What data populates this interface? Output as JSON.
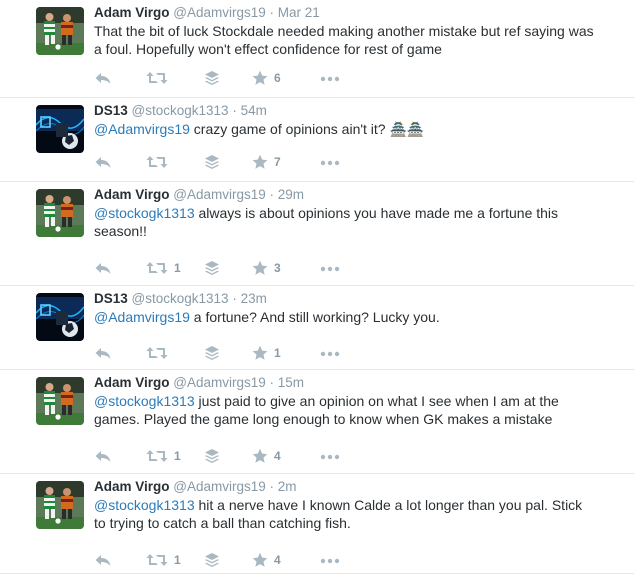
{
  "tweets": [
    {
      "name": "Adam Virgo",
      "handle": "@Adamvirgs19",
      "time": "· Mar 21",
      "mention": "",
      "text": "That the bit of luck Stockdale needed making another mistake but ref saying was a foul. Hopefully won't effect confidence for rest of game",
      "retweets": "",
      "likes": "6",
      "avatar": "football"
    },
    {
      "name": "DS13",
      "handle": "@stockogk1313",
      "time": "· 54m",
      "mention": "@Adamvirgs19",
      "text": " crazy game of opinions ain't it? 🏯🏯",
      "retweets": "",
      "likes": "7",
      "avatar": "ds13"
    },
    {
      "name": "Adam Virgo",
      "handle": "@Adamvirgs19",
      "time": "· 29m",
      "mention": "@stockogk1313",
      "text": " always is about opinions you have made me a fortune this season!!",
      "retweets": "1",
      "likes": "3",
      "avatar": "football"
    },
    {
      "name": "DS13",
      "handle": "@stockogk1313",
      "time": "· 23m",
      "mention": "@Adamvirgs19",
      "text": " a fortune? And still working? Lucky you.",
      "retweets": "",
      "likes": "1",
      "avatar": "ds13"
    },
    {
      "name": "Adam Virgo",
      "handle": "@Adamvirgs19",
      "time": "· 15m",
      "mention": "@stockogk1313",
      "text": " just paid to give an opinion on what I see when I am at the games. Played the game long enough to know when GK makes a mistake",
      "retweets": "1",
      "likes": "4",
      "avatar": "football"
    },
    {
      "name": "Adam Virgo",
      "handle": "@Adamvirgs19",
      "time": "· 2m",
      "mention": "@stockogk1313",
      "text": " hit a nerve have I known Calde a lot longer than you pal. Stick to trying to catch a ball than catching fish.",
      "retweets": "1",
      "likes": "4",
      "avatar": "football"
    }
  ],
  "icons": {
    "reply": "reply-icon",
    "retweet": "retweet-icon",
    "buffer": "buffer-stack-icon",
    "like": "star-icon",
    "more": "more-dots-icon"
  },
  "colors": {
    "mention": "#2b7bb9",
    "meta": "#8899a6",
    "icon": "#aab8c2",
    "divider": "#e1e8ed"
  }
}
